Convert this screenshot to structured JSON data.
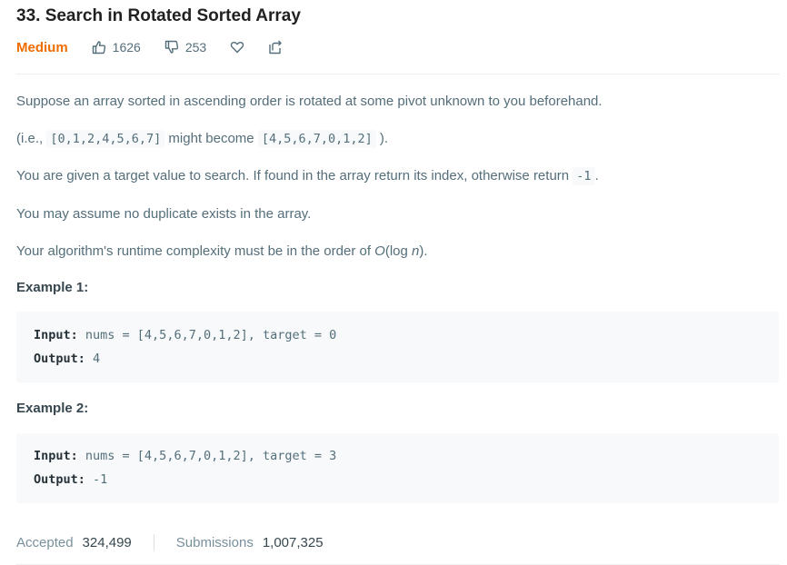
{
  "problem": {
    "title": "33. Search in Rotated Sorted Array",
    "difficulty": "Medium",
    "likes": "1626",
    "dislikes": "253",
    "accent": "#ef6c00"
  },
  "icons": {
    "like": "thumbs-up-icon",
    "dislike": "thumbs-down-icon",
    "favorite": "heart-icon",
    "share": "share-icon"
  },
  "description": {
    "p1": "Suppose an array sorted in ascending order is rotated at some pivot unknown to you beforehand.",
    "p2_pre": "(i.e., ",
    "p2_code1": "[0,1,2,4,5,6,7]",
    "p2_mid": " might become ",
    "p2_code2": "[4,5,6,7,0,1,2]",
    "p2_post": " ).",
    "p3_pre": "You are given a target value to search. If found in the array return its index, otherwise return ",
    "p3_code": "-1",
    "p3_post": ".",
    "p4": "You may assume no duplicate exists in the array.",
    "p5_pre": "Your algorithm's runtime complexity must be in the order of ",
    "p5_em1": "O",
    "p5_mid": "(log ",
    "p5_em2": "n",
    "p5_post": ")."
  },
  "examples": [
    {
      "title": "Example 1:",
      "input_label": "Input:",
      "input_value": " nums = [4,5,6,7,0,1,2], target = 0",
      "output_label": "Output:",
      "output_value": " 4"
    },
    {
      "title": "Example 2:",
      "input_label": "Input:",
      "input_value": " nums = [4,5,6,7,0,1,2], target = 3",
      "output_label": "Output:",
      "output_value": " -1"
    }
  ],
  "stats": {
    "accepted_label": "Accepted",
    "accepted_value": "324,499",
    "submissions_label": "Submissions",
    "submissions_value": "1,007,325"
  }
}
